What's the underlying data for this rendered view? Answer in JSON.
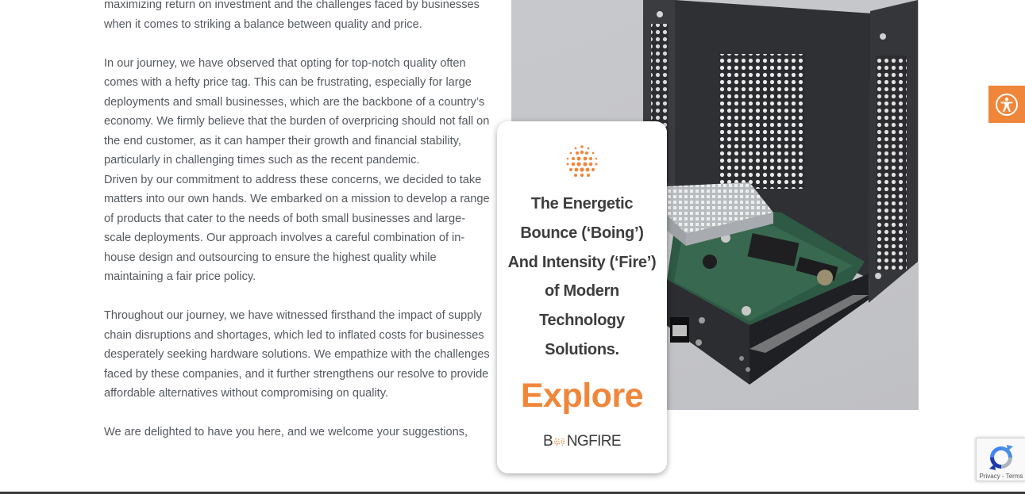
{
  "article": {
    "paragraphs": [
      "maximizing return on investment and the challenges faced by businesses when it comes to striking a balance between quality and price.",
      "In our journey, we have observed that opting for top-notch quality often comes with a hefty price tag. This can be frustrating, especially for large deployments and small businesses, which are the backbone of a country’s economy. We firmly believe that the burden of overpricing should not fall on the end customer, as it can hamper their growth and financial stability, particularly in challenging times such as the recent pandemic.",
      "Driven by our commitment to address these concerns, we decided to take matters into our own hands. We embarked on a mission to develop a range of products that cater to the needs of both small businesses and large-scale deployments. Our approach involves a careful combination of in-house design and outsourcing to ensure the highest quality while maintaining a fair price policy.",
      "Throughout our journey, we have witnessed firsthand the impact of supply chain disruptions and shortages, which led to inflated costs for businesses desperately seeking hardware solutions. We empathize with the challenges faced by these companies, and it further strengthens our resolve to provide affordable alternatives without compromising on quality.",
      "We are delighted to have you here, and we welcome your suggestions,"
    ]
  },
  "promo": {
    "headline": "The Energetic Bounce (‘Boing’) And Intensity (‘Fire’) of Modern Technology Solutions.",
    "cta": "Explore",
    "brand_b": "B",
    "brand_rest": "NGFIRE",
    "brand_name": "BOINGFIRE",
    "accent_color": "#f0863a"
  },
  "accessibility": {
    "icon": "accessibility-icon"
  },
  "recaptcha": {
    "privacy": "Privacy",
    "separator": " - ",
    "terms": "Terms"
  }
}
